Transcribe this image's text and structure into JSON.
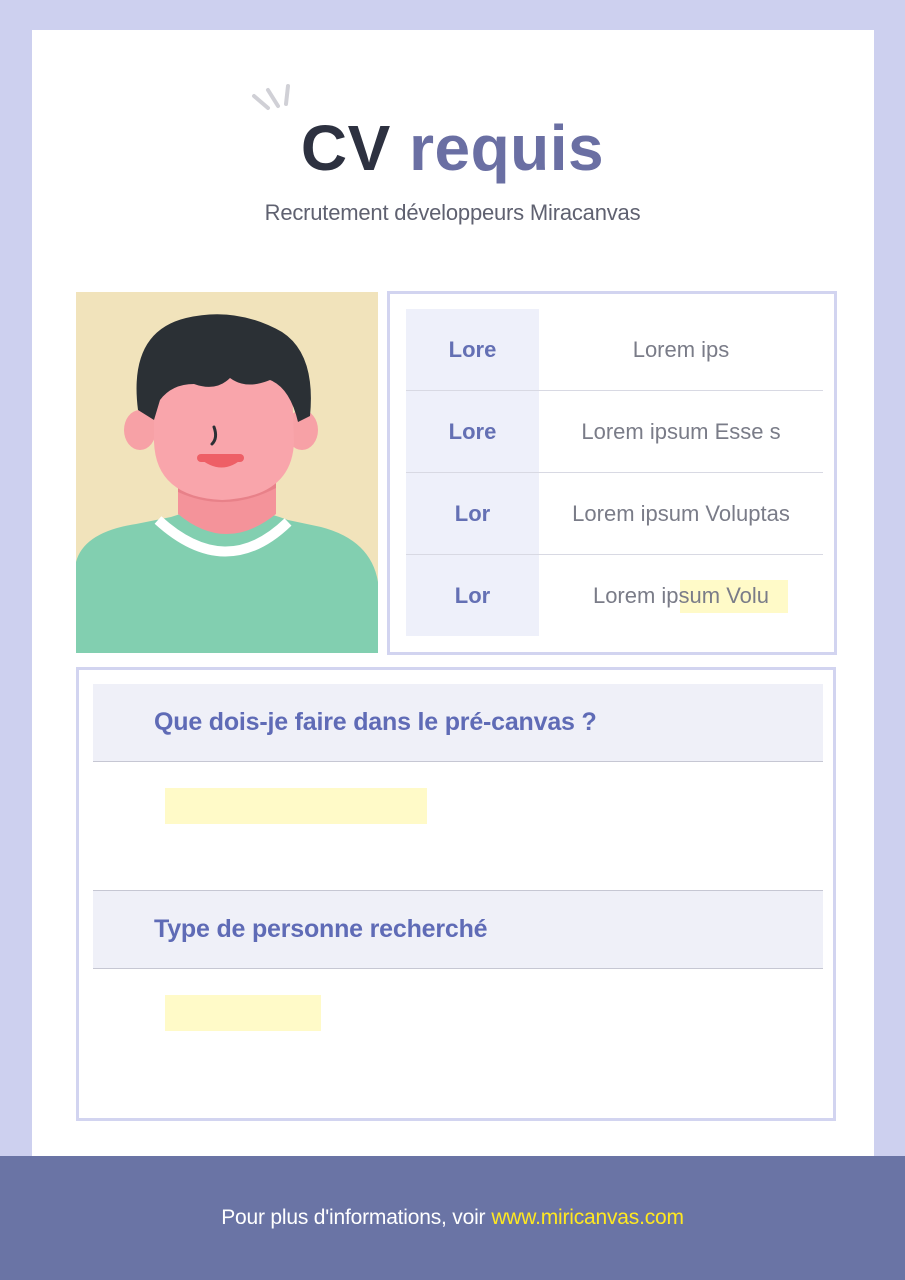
{
  "header": {
    "title_part1": "CV",
    "title_part2": "requis",
    "subtitle": "Recrutement développeurs Miracanvas"
  },
  "profile": {
    "photo_icon": "person-avatar-illustration",
    "rows": [
      {
        "label": "Lore",
        "value": "Lorem ips"
      },
      {
        "label": "Lore",
        "value": "Lorem ipsum Esse s"
      },
      {
        "label": "Lor",
        "value": "Lorem ipsum Voluptas"
      },
      {
        "label": "Lor",
        "value": "Lorem ipsum Volu"
      }
    ]
  },
  "questions": [
    {
      "heading": "Que dois-je faire dans le pré-canvas ?"
    },
    {
      "heading": "Type de personne recherché"
    }
  ],
  "footer": {
    "text": "Pour plus d'informations, voir",
    "link": "www.miricanvas.com"
  },
  "colors": {
    "background": "#cdd0ef",
    "accent": "#6a74a5",
    "heading_blue": "#5f6bb6",
    "highlight": "#fffac8",
    "link_yellow": "#ffe820"
  }
}
